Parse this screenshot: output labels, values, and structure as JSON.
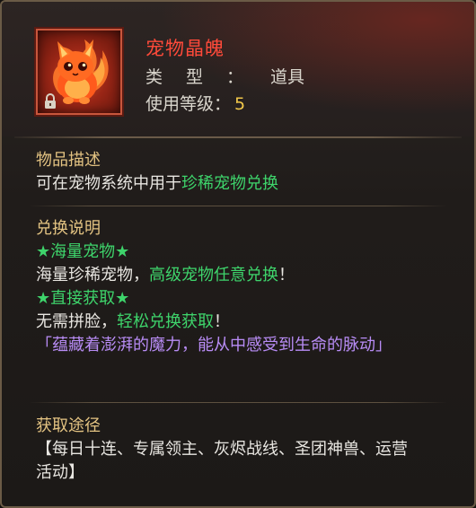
{
  "item": {
    "name": "宠物晶魄",
    "type_label": "类型：",
    "type_value": "道具",
    "level_label": "使用等级：",
    "level_value": "5",
    "icon": "fire-fox-pet-icon",
    "locked_icon": "lock-icon"
  },
  "description": {
    "title": "物品描述",
    "text_prefix": "可在宠物系统中用于",
    "text_highlight": "珍稀宠物兑换"
  },
  "exchange": {
    "title": "兑换说明",
    "star1": "★海量宠物★",
    "line1_prefix": "海量珍稀宠物，",
    "line1_highlight": "高级宠物任意兑换",
    "line1_suffix": "！",
    "star2": "★直接获取★",
    "line2_prefix": "无需拼脸，",
    "line2_highlight": "轻松兑换获取",
    "line2_suffix": "！",
    "flavor": "「蕴藏着澎湃的魔力，能从中感受到生命的脉动」"
  },
  "source": {
    "title": "获取途径",
    "text": "【每日十连、专属领主、灰烬战线、圣团神兽、运营活动】"
  },
  "colors": {
    "name": "#ff4a3a",
    "section_title": "#e3c382",
    "highlight_green": "#3ed46b",
    "flavor_purple": "#b88cf5",
    "level_number": "#f2c84a"
  }
}
